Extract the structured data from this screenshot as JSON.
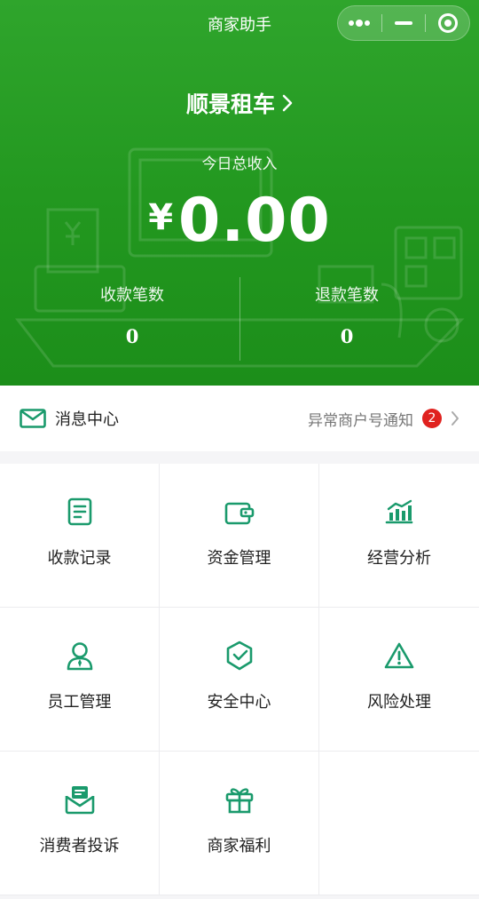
{
  "nav": {
    "title": "商家助手",
    "capsule_icons": [
      "more-icon",
      "minimize-icon",
      "close-target-icon"
    ]
  },
  "header": {
    "merchant_name": "顺景租车",
    "today_label": "今日总收入",
    "currency_symbol": "¥",
    "amount": "0.00",
    "stats": [
      {
        "label": "收款笔数",
        "value": "0"
      },
      {
        "label": "退款笔数",
        "value": "0"
      }
    ]
  },
  "message_bar": {
    "label": "消息中心",
    "notice": "异常商户号通知",
    "badge_count": "2"
  },
  "menu": {
    "items": [
      {
        "label": "收款记录",
        "icon": "receipt-icon"
      },
      {
        "label": "资金管理",
        "icon": "wallet-icon"
      },
      {
        "label": "经营分析",
        "icon": "bar-chart-icon"
      },
      {
        "label": "员工管理",
        "icon": "staff-icon"
      },
      {
        "label": "安全中心",
        "icon": "shield-icon"
      },
      {
        "label": "风险处理",
        "icon": "warning-icon"
      },
      {
        "label": "消费者投诉",
        "icon": "complaint-envelope-icon"
      },
      {
        "label": "商家福利",
        "icon": "gift-icon"
      }
    ]
  },
  "colors": {
    "brand_green": "#22971f",
    "icon_green": "#1a9a6c",
    "badge_red": "#e0221f"
  }
}
